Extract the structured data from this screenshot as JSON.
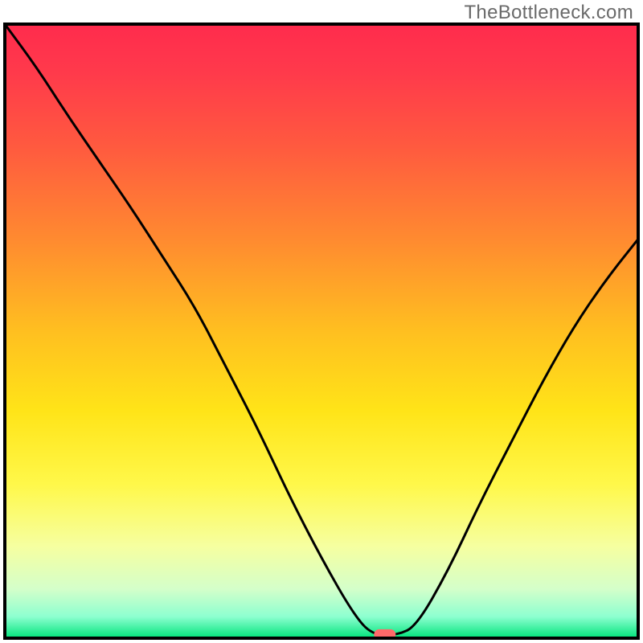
{
  "watermark": "TheBottleneck.com",
  "chart_data": {
    "type": "line",
    "title": "",
    "xlabel": "",
    "ylabel": "",
    "xlim": [
      0,
      100
    ],
    "ylim": [
      0,
      100
    ],
    "series": [
      {
        "name": "bottleneck-curve",
        "x": [
          0,
          5,
          10,
          15,
          20,
          25,
          30,
          35,
          40,
          45,
          50,
          55,
          58,
          62,
          65,
          70,
          75,
          80,
          85,
          90,
          95,
          100
        ],
        "y": [
          100,
          93,
          85,
          77.5,
          70,
          62,
          54,
          44,
          34,
          23,
          13,
          4,
          0.5,
          0.5,
          2,
          11,
          22,
          32,
          42,
          51,
          58.5,
          65
        ]
      }
    ],
    "marker": {
      "x": 60,
      "y": 0.6
    },
    "gradient_stops": [
      {
        "offset": 0.0,
        "color": "#ff2b4d"
      },
      {
        "offset": 0.08,
        "color": "#ff3a4b"
      },
      {
        "offset": 0.2,
        "color": "#ff5a3f"
      },
      {
        "offset": 0.35,
        "color": "#ff8a30"
      },
      {
        "offset": 0.5,
        "color": "#ffbf20"
      },
      {
        "offset": 0.63,
        "color": "#ffe418"
      },
      {
        "offset": 0.75,
        "color": "#fff84a"
      },
      {
        "offset": 0.85,
        "color": "#f6ffa0"
      },
      {
        "offset": 0.92,
        "color": "#d4ffca"
      },
      {
        "offset": 0.965,
        "color": "#8dffd0"
      },
      {
        "offset": 1.0,
        "color": "#00e47a"
      }
    ],
    "colors": {
      "curve": "#000000",
      "marker_fill": "#ff6a6a",
      "marker_stroke": "#ff6a6a",
      "border": "#000000"
    }
  }
}
